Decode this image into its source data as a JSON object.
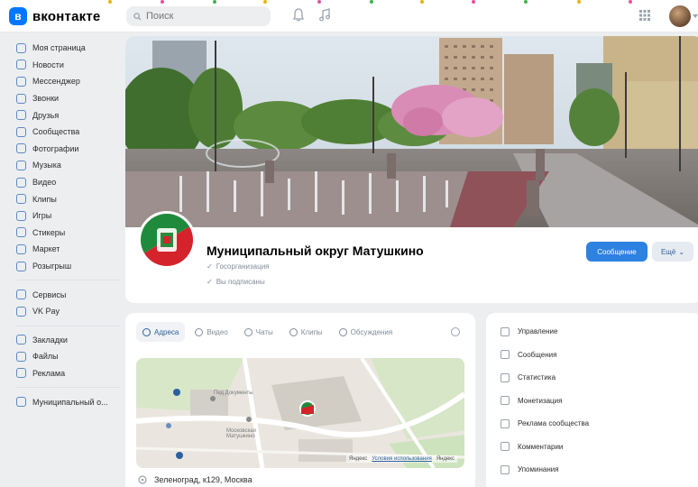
{
  "header": {
    "logo_text": "вконтакте",
    "logo_mark": "в",
    "search_placeholder": "Поиск",
    "icons": [
      "bell-icon",
      "music-icon",
      "apps-icon"
    ]
  },
  "sidebar": {
    "items": [
      {
        "label": "Моя страница",
        "icon": "user-icon"
      },
      {
        "label": "Новости",
        "icon": "news-icon"
      },
      {
        "label": "Мессенджер",
        "icon": "message-icon"
      },
      {
        "label": "Звонки",
        "icon": "phone-icon"
      },
      {
        "label": "Друзья",
        "icon": "friends-icon"
      },
      {
        "label": "Сообщества",
        "icon": "groups-icon"
      },
      {
        "label": "Фотографии",
        "icon": "photo-icon"
      },
      {
        "label": "Музыка",
        "icon": "music-icon"
      },
      {
        "label": "Видео",
        "icon": "video-icon"
      },
      {
        "label": "Клипы",
        "icon": "clips-icon"
      },
      {
        "label": "Игры",
        "icon": "games-icon"
      },
      {
        "label": "Стикеры",
        "icon": "sticker-icon"
      },
      {
        "label": "Маркет",
        "icon": "market-icon"
      },
      {
        "label": "Розыгрыш",
        "icon": "gift-icon"
      }
    ],
    "items2": [
      {
        "label": "Сервисы",
        "icon": "services-icon"
      },
      {
        "label": "VK Pay",
        "icon": "pay-icon"
      }
    ],
    "items3": [
      {
        "label": "Закладки",
        "icon": "bookmark-icon"
      },
      {
        "label": "Файлы",
        "icon": "file-icon"
      },
      {
        "label": "Реклама",
        "icon": "ads-icon"
      }
    ],
    "items4": [
      {
        "label": "Муниципальный о...",
        "icon": "community-icon"
      }
    ]
  },
  "community": {
    "name": "Муниципальный округ Матушкино",
    "type": "Госорганизация",
    "subscription": "Вы подписаны",
    "primary_button": "Сообщение",
    "secondary_button": "Ещё"
  },
  "info": {
    "tabs": [
      {
        "label": "Адреса",
        "active": true
      },
      {
        "label": "Видео",
        "active": false
      },
      {
        "label": "Чаты",
        "active": false
      },
      {
        "label": "Клипы",
        "active": false
      },
      {
        "label": "Обсуждения",
        "active": false
      }
    ],
    "map_labels": {
      "place1": "Пед Документы",
      "place2": "Московская\nМатушкино",
      "attrib_brand": "Яндекс",
      "attrib_link": "Условия использования",
      "attrib_right": "Яндекс"
    },
    "address": "Зеленоград, к129, Москва"
  },
  "manage": {
    "items": [
      {
        "label": "Управление",
        "icon": "settings-icon"
      },
      {
        "label": "Сообщения",
        "icon": "message-icon"
      },
      {
        "label": "Статистика",
        "icon": "stats-icon"
      },
      {
        "label": "Монетизация",
        "icon": "money-icon"
      },
      {
        "label": "Реклама сообщества",
        "icon": "ads-icon"
      },
      {
        "label": "Комментарии",
        "icon": "comment-icon"
      },
      {
        "label": "Упоминания",
        "icon": "mention-icon"
      }
    ]
  },
  "colors": {
    "accent": "#2d81e0",
    "brand": "#0077ff",
    "background": "#edeef0"
  }
}
